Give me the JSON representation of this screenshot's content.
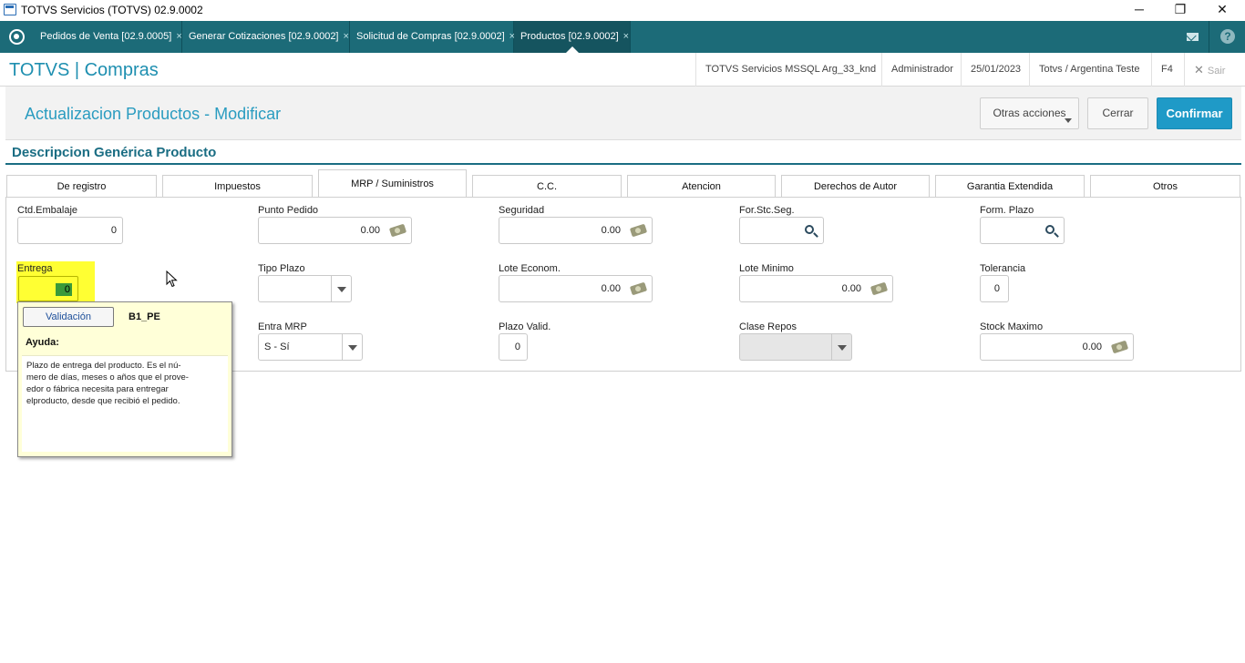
{
  "window": {
    "title": "TOTVS Servicios (TOTVS) 02.9.0002",
    "minimize": "─",
    "restore": "❐",
    "close": "✕"
  },
  "tabs": [
    {
      "label": "Pedidos de Venta [02.9.0005]",
      "close": "×"
    },
    {
      "label": "Generar Cotizaciones [02.9.0002]",
      "close": "×"
    },
    {
      "label": "Solicitud de Compras [02.9.0002]",
      "close": "×"
    },
    {
      "label": "Productos [02.9.0002]",
      "close": "×"
    }
  ],
  "header": {
    "app_title": "TOTVS | Compras",
    "environment": "TOTVS Servicios MSSQL Arg_33_knd",
    "user": "Administrador",
    "date": "25/01/2023",
    "company": "Totvs / Argentina Teste",
    "shortcut": "F4",
    "exit": "Sair",
    "exit_icon": "✕",
    "help": "?"
  },
  "page": {
    "title": "Actualizacion Productos - Modificar",
    "other_actions": "Otras acciones",
    "close": "Cerrar",
    "confirm": "Confirmar",
    "section_title": "Descripcion Genérica Producto"
  },
  "form_tabs": [
    "De registro",
    "Impuestos",
    "MRP / Suministros",
    "C.C.",
    "Atencion",
    "Derechos de Autor",
    "Garantia Extendida",
    "Otros"
  ],
  "fields": {
    "ctd_embalaje": {
      "label": "Ctd.Embalaje",
      "value": "0"
    },
    "punto_pedido": {
      "label": "Punto Pedido",
      "value": "0.00"
    },
    "seguridad": {
      "label": "Seguridad",
      "value": "0.00"
    },
    "for_stc_seg": {
      "label": "For.Stc.Seg.",
      "value": ""
    },
    "form_plazo": {
      "label": "Form. Plazo",
      "value": ""
    },
    "entrega": {
      "label": "Entrega",
      "value": "0"
    },
    "tipo_plazo": {
      "label": "Tipo Plazo",
      "value": ""
    },
    "lote_econom": {
      "label": "Lote Econom.",
      "value": "0.00"
    },
    "lote_minimo": {
      "label": "Lote Minimo",
      "value": "0.00"
    },
    "tolerancia": {
      "label": "Tolerancia",
      "value": "0"
    },
    "entra_mrp": {
      "label": "Entra MRP",
      "value": "S - Sí"
    },
    "plazo_valid": {
      "label": "Plazo Valid.",
      "value": "0"
    },
    "clase_repos": {
      "label": "Clase Repos",
      "value": ""
    },
    "stock_maximo": {
      "label": "Stock Maximo",
      "value": "0.00"
    }
  },
  "tooltip": {
    "validation_button": "Validación",
    "field_code": "B1_PE",
    "help_title": "Ayuda:",
    "help_text": "Plazo de entrega del producto. Es el nú-mero de días, meses o años que el prove-edor o fábrica necesita para entregar elproducto, desde que recibió el pedido."
  },
  "colors": {
    "tabbar": "#1c6b78",
    "accent": "#1f9ac7",
    "highlight": "#ffff33",
    "tooltip_bg": "#ffffd8"
  }
}
